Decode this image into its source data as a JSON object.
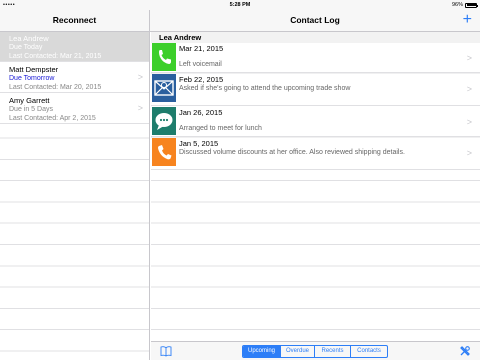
{
  "status": {
    "carrier": "•••••",
    "time": "5:28 PM",
    "battery": "96%"
  },
  "master": {
    "title": "Reconnect",
    "people": [
      {
        "name": "Lea Andrew",
        "due": "Due Today",
        "last": "Last Contacted: Mar 21, 2015",
        "selected": true
      },
      {
        "name": "Matt Dempster",
        "due": "Due Tomorrow",
        "last": "Last Contacted: Mar 20, 2015",
        "selected": false
      },
      {
        "name": "Amy Garrett",
        "due": "Due in 5 Days",
        "last": "Last Contacted: Apr 2, 2015",
        "selected": false
      }
    ]
  },
  "detail": {
    "title": "Contact Log",
    "add_label": "+",
    "person": "Lea Andrew",
    "entries": [
      {
        "date": "Mar 21, 2015",
        "note": "Left voicemail",
        "icon": "phone-icon",
        "color": "#3ccf2a"
      },
      {
        "date": "Feb 22, 2015",
        "note": "Asked if she's going to attend the upcoming trade show",
        "icon": "email-icon",
        "color": "#2a5f9e"
      },
      {
        "date": "Jan 26, 2015",
        "note": "Arranged to meet for lunch",
        "icon": "chat-icon",
        "color": "#1e7d6c"
      },
      {
        "date": "Jan 5, 2015",
        "note": "Discussed volume discounts at her office. Also reviewed shipping details.",
        "icon": "phone-icon",
        "color": "#f7841f"
      }
    ]
  },
  "toolbar": {
    "segments": [
      "Upcoming",
      "Overdue",
      "Recents",
      "Contacts"
    ],
    "active_segment": "Upcoming",
    "accent": "#2d7ef7"
  }
}
